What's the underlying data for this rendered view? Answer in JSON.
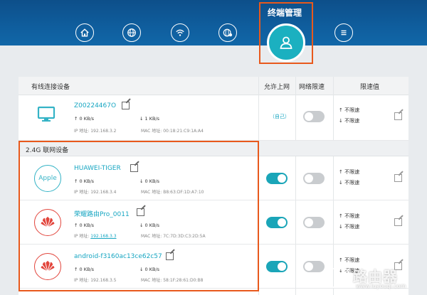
{
  "header": {
    "title": "终端管理"
  },
  "nav_icons": [
    "home-icon",
    "globe-icon",
    "wifi-icon",
    "globe-settings-icon",
    "user-icon",
    "menu-icon"
  ],
  "table_header": {
    "wired": "有线连接设备",
    "allow_internet": "允许上网",
    "net_limit": "网络限速",
    "limit_value": "限速值"
  },
  "wired_devices": [
    {
      "name": "Z00224467O",
      "up": "0 KB/s",
      "down": "1 KB/s",
      "ip": "IP 地址: 192.168.3.2",
      "mac": "MAC 地址: 00:18:21:C9:1A:A4",
      "status": "（自己）",
      "limit_up": "不限速",
      "limit_down": "不限速",
      "speed_limit_on": false
    }
  ],
  "wifi_section": {
    "label": "2.4G 联网设备"
  },
  "wifi_devices": [
    {
      "name": "HUAWEI-TIGER",
      "icon_text": "Apple",
      "up": "0 KB/s",
      "down": "0 KB/s",
      "ip": "IP 地址: 192.168.3.4",
      "mac": "MAC 地址: B8:63:DF:1D:A7:10",
      "limit_up": "不限速",
      "limit_down": "不限速",
      "internet_on": true,
      "speed_limit_on": false
    },
    {
      "name": "荣耀路由Pro_0011",
      "up": "0 KB/s",
      "down": "0 KB/s",
      "ip_label": "IP 地址:",
      "ip_value": "192.168.3.3",
      "mac": "MAC 地址: 7C:7D:3D:C3:2D:5A",
      "limit_up": "不限速",
      "limit_down": "不限速",
      "internet_on": true,
      "speed_limit_on": false
    },
    {
      "name": "android-f3160ac13ce62c57",
      "up": "0 KB/s",
      "down": "0 KB/s",
      "ip": "IP 地址: 192.168.3.5",
      "mac": "MAC 地址: 58:1F:28:61:D0:B8",
      "limit_up": "不限速",
      "limit_down": "不限速",
      "internet_on": true,
      "speed_limit_on": false
    }
  ],
  "watermark": {
    "main": "路由器",
    "sub": "www.luyouqi.com"
  },
  "colors": {
    "header": "#0f5e9e",
    "accent": "#1aa5b8",
    "highlight": "#e8591c",
    "huawei_red": "#e2453c"
  }
}
